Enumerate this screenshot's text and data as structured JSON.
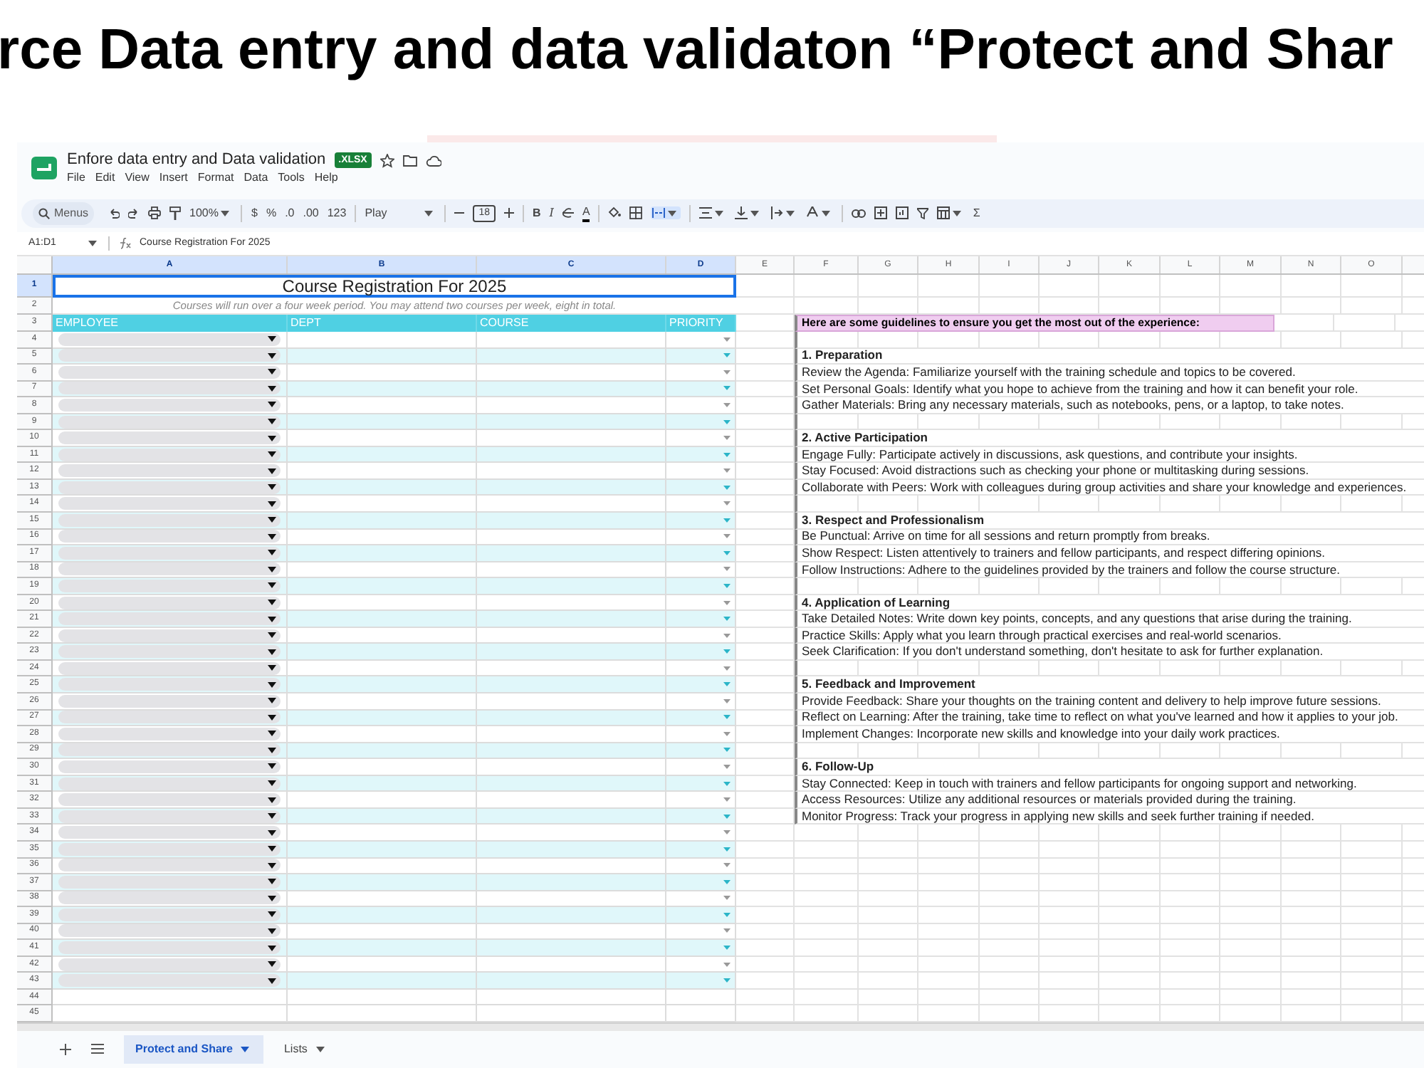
{
  "slide_title": "rce Data entry and data validaton “Protect and Shar",
  "doc": {
    "title": "Enfore data entry and Data validation",
    "badge": ".XLSX",
    "menus": [
      "File",
      "Edit",
      "View",
      "Insert",
      "Format",
      "Data",
      "Tools",
      "Help"
    ]
  },
  "toolbar": {
    "search": "Menus",
    "zoom": "100%",
    "currency": "$",
    "percent": "%",
    "decrease_decimal": ".0",
    "increase_decimal": ".00",
    "number_format": "123",
    "font": "Play",
    "font_size": "18",
    "bold": "B",
    "italic": "I",
    "text_color": "A",
    "functions": "Σ"
  },
  "formula_bar": {
    "cell_ref": "A1:D1",
    "formula": "Course Registration For 2025"
  },
  "columns": [
    {
      "label": "A",
      "selected": true
    },
    {
      "label": "B",
      "selected": true
    },
    {
      "label": "C",
      "selected": true
    },
    {
      "label": "D",
      "selected": true
    },
    {
      "label": "E",
      "selected": false
    },
    {
      "label": "F",
      "selected": false
    },
    {
      "label": "G",
      "selected": false
    },
    {
      "label": "H",
      "selected": false
    },
    {
      "label": "I",
      "selected": false
    },
    {
      "label": "J",
      "selected": false
    },
    {
      "label": "K",
      "selected": false
    },
    {
      "label": "L",
      "selected": false
    },
    {
      "label": "M",
      "selected": false
    },
    {
      "label": "N",
      "selected": false
    },
    {
      "label": "O",
      "selected": false
    }
  ],
  "title_row": {
    "number": "1",
    "text": "Course Registration For 2025",
    "selected": true
  },
  "subtitle_row": {
    "number": "2",
    "text": "Courses will run over a four week period. You may attend two courses per week, eight in total."
  },
  "header_row": {
    "number": "3",
    "headers": [
      "EMPLOYEE",
      "DEPT",
      "COURSE",
      "PRIORITY"
    ]
  },
  "rows": [
    {
      "number": "4",
      "kind": "entry"
    },
    {
      "number": "5",
      "kind": "entry"
    },
    {
      "number": "6",
      "kind": "entry"
    },
    {
      "number": "7",
      "kind": "entry"
    },
    {
      "number": "8",
      "kind": "entry"
    },
    {
      "number": "9",
      "kind": "entry"
    },
    {
      "number": "10",
      "kind": "entry"
    },
    {
      "number": "11",
      "kind": "entry"
    },
    {
      "number": "12",
      "kind": "entry"
    },
    {
      "number": "13",
      "kind": "entry"
    },
    {
      "number": "14",
      "kind": "entry"
    },
    {
      "number": "15",
      "kind": "entry"
    },
    {
      "number": "16",
      "kind": "entry"
    },
    {
      "number": "17",
      "kind": "entry"
    },
    {
      "number": "18",
      "kind": "entry"
    },
    {
      "number": "19",
      "kind": "entry"
    },
    {
      "number": "20",
      "kind": "entry"
    },
    {
      "number": "21",
      "kind": "entry"
    },
    {
      "number": "22",
      "kind": "entry"
    },
    {
      "number": "23",
      "kind": "entry"
    },
    {
      "number": "24",
      "kind": "entry"
    },
    {
      "number": "25",
      "kind": "entry"
    },
    {
      "number": "26",
      "kind": "entry"
    },
    {
      "number": "27",
      "kind": "entry"
    },
    {
      "number": "28",
      "kind": "entry"
    },
    {
      "number": "29",
      "kind": "entry"
    },
    {
      "number": "30",
      "kind": "entry"
    },
    {
      "number": "31",
      "kind": "entry"
    },
    {
      "number": "32",
      "kind": "entry"
    },
    {
      "number": "33",
      "kind": "entry"
    },
    {
      "number": "34",
      "kind": "entry"
    },
    {
      "number": "35",
      "kind": "entry"
    },
    {
      "number": "36",
      "kind": "entry"
    },
    {
      "number": "37",
      "kind": "entry"
    },
    {
      "number": "38",
      "kind": "entry"
    },
    {
      "number": "39",
      "kind": "entry"
    },
    {
      "number": "40",
      "kind": "entry"
    },
    {
      "number": "41",
      "kind": "entry"
    },
    {
      "number": "42",
      "kind": "entry"
    },
    {
      "number": "43",
      "kind": "entry"
    },
    {
      "number": "44",
      "kind": "blank"
    },
    {
      "number": "45",
      "kind": "blank"
    }
  ],
  "guidelines": {
    "heading": "Here are some guidelines to ensure you get the most out of the experience:",
    "sections": [
      {
        "title": "1. Preparation",
        "items": [
          "Review the Agenda: Familiarize yourself with the training schedule and topics to be covered.",
          "Set Personal Goals: Identify what you hope to achieve from the training and how it can benefit your role.",
          "Gather Materials: Bring any necessary materials, such as notebooks, pens, or a laptop, to take notes."
        ]
      },
      {
        "title": "2. Active Participation",
        "items": [
          "Engage Fully: Participate actively in discussions, ask questions, and contribute your insights.",
          "Stay Focused: Avoid distractions such as checking your phone or multitasking during sessions.",
          "Collaborate with Peers: Work with colleagues during group activities and share your knowledge and experiences."
        ]
      },
      {
        "title": "3. Respect and Professionalism",
        "items": [
          "Be Punctual: Arrive on time for all sessions and return promptly from breaks.",
          "Show Respect: Listen attentively to trainers and fellow participants, and respect differing opinions.",
          "Follow Instructions: Adhere to the guidelines provided by the trainers and follow the course structure."
        ]
      },
      {
        "title": "4. Application of Learning",
        "items": [
          "Take Detailed Notes: Write down key points, concepts, and any questions that arise during the training.",
          "Practice Skills: Apply what you learn through practical exercises and real-world scenarios.",
          "Seek Clarification: If you don't understand something, don't hesitate to ask for further explanation."
        ]
      },
      {
        "title": "5. Feedback and Improvement",
        "items": [
          "Provide Feedback: Share your thoughts on the training content and delivery to help improve future sessions.",
          "Reflect on Learning: After the training, take time to reflect on what you've learned and how it applies to your job.",
          "Implement Changes: Incorporate new skills and knowledge into your daily work practices."
        ]
      },
      {
        "title": "6. Follow-Up",
        "items": [
          "Stay Connected: Keep in touch with trainers and fellow participants for ongoing support and networking.",
          "Access Resources: Utilize any additional resources or materials provided during the training.",
          "Monitor Progress: Track your progress in applying new skills and seek further training if needed."
        ]
      }
    ]
  },
  "sheet_tabs": [
    {
      "label": "Protect and Share",
      "selected": true
    },
    {
      "label": "Lists",
      "selected": false
    }
  ]
}
